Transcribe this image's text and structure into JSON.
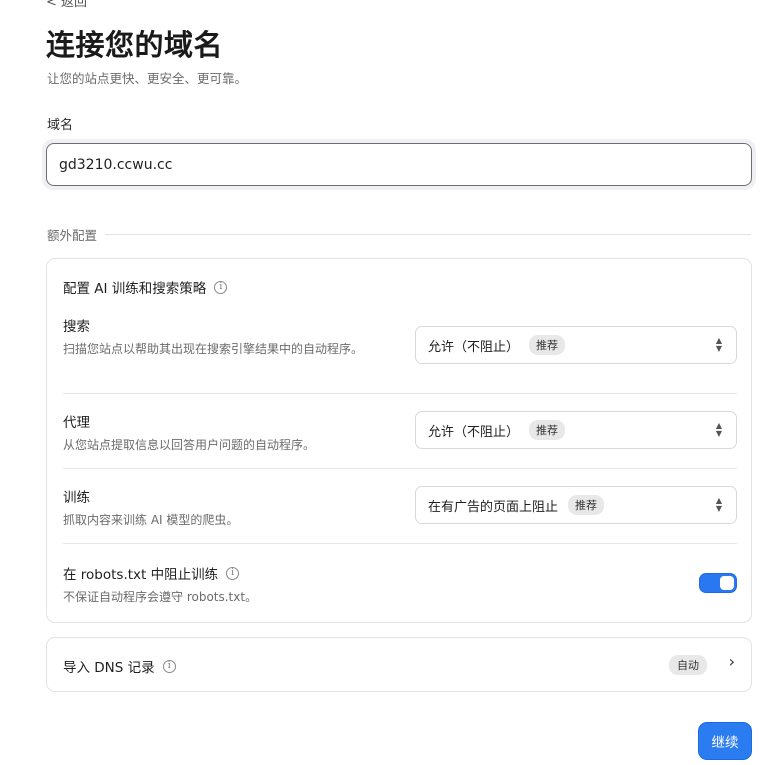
{
  "header": {
    "back_text": "< 返回",
    "title": "连接您的域名",
    "subtitle": "让您的站点更快、更安全、更可靠。"
  },
  "domain": {
    "label": "域名",
    "value": "gd3210.ccwu.cc"
  },
  "extra": {
    "section_label": "额外配置",
    "ai_title": "配置 AI 训练和搜索策略",
    "rows": [
      {
        "title": "搜索",
        "desc": "扫描您站点以帮助其出现在搜索引擎结果中的自动程序。",
        "select_value": "允许（不阻止）",
        "badge": "推荐"
      },
      {
        "title": "代理",
        "desc": "从您站点提取信息以回答用户问题的自动程序。",
        "select_value": "允许（不阻止）",
        "badge": "推荐"
      },
      {
        "title": "训练",
        "desc": "抓取内容来训练 AI 模型的爬虫。",
        "select_value": "在有广告的页面上阻止",
        "badge": "推荐"
      }
    ],
    "robots": {
      "title": "在 robots.txt 中阻止训练",
      "desc": "不保证自动程序会遵守 robots.txt。",
      "enabled": true
    }
  },
  "dns": {
    "label": "导入 DNS 记录",
    "badge": "自动"
  },
  "actions": {
    "continue_label": "继续"
  },
  "colors": {
    "accent": "#2b7cf0"
  }
}
